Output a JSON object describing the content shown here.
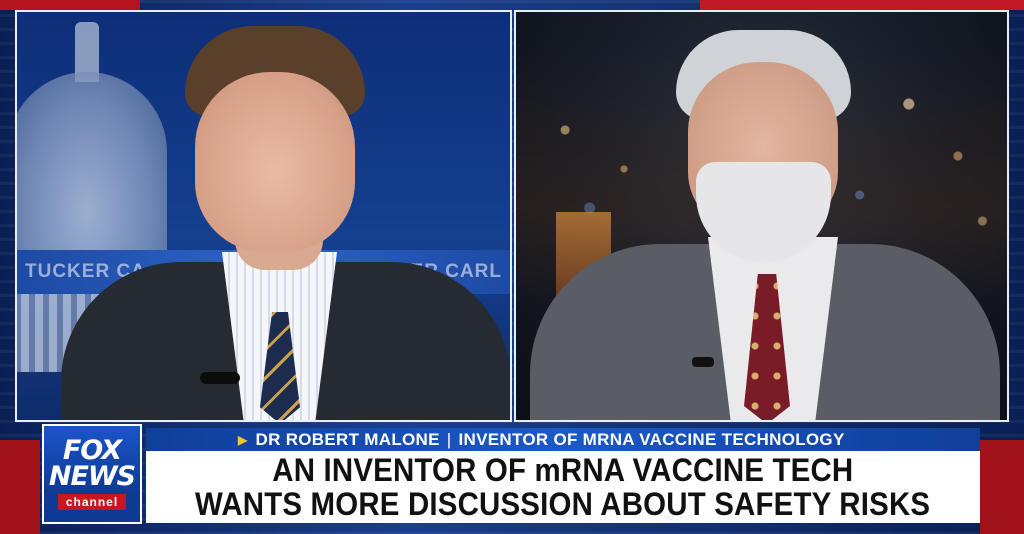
{
  "network": {
    "logo_line1": "FOX",
    "logo_line2": "NEWS",
    "logo_subtitle": "channel",
    "brand_color": "#0e3a95",
    "accent_color": "#c8161e"
  },
  "host_panel": {
    "background_text_left": "TUCKER CA",
    "background_text_right": "KER CARL"
  },
  "lower_third": {
    "name": "DR ROBERT MALONE",
    "separator": "|",
    "title": "INVENTOR OF MRNA VACCINE TECHNOLOGY",
    "headline_line1": "AN INVENTOR OF mRNA VACCINE TECH",
    "headline_line2": "WANTS MORE DISCUSSION ABOUT SAFETY RISKS",
    "arrow_icon": "triangle-right-icon"
  }
}
